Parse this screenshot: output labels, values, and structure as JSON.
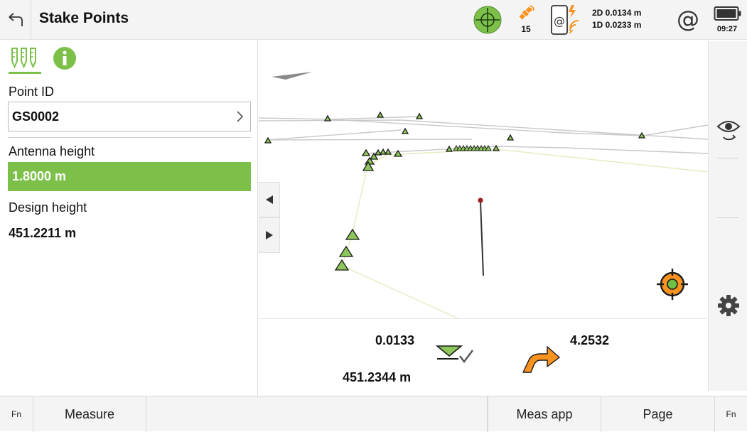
{
  "header": {
    "title": "Stake Points",
    "satellites": "15",
    "precision_2d": "2D 0.0134 m",
    "precision_1d": "1D 0.0233 m",
    "time": "09:27"
  },
  "form": {
    "point_id_label": "Point ID",
    "point_id_value": "GS0002",
    "antenna_height_label": "Antenna height",
    "antenna_height_value": "1.8000 m",
    "design_height_label": "Design height",
    "design_height_value": "451.2211 m"
  },
  "stakeout": {
    "cut_fill": "0.0133",
    "height": "451.2344 m",
    "turn_distance": "4.2532"
  },
  "bottom": {
    "fn_left": "Fn",
    "measure": "Measure",
    "meas_app": "Meas app",
    "page": "Page",
    "fn_right": "Fn"
  },
  "colors": {
    "accent": "#7cc04a",
    "arrow": "#f7931e",
    "target": "#f7931e"
  }
}
